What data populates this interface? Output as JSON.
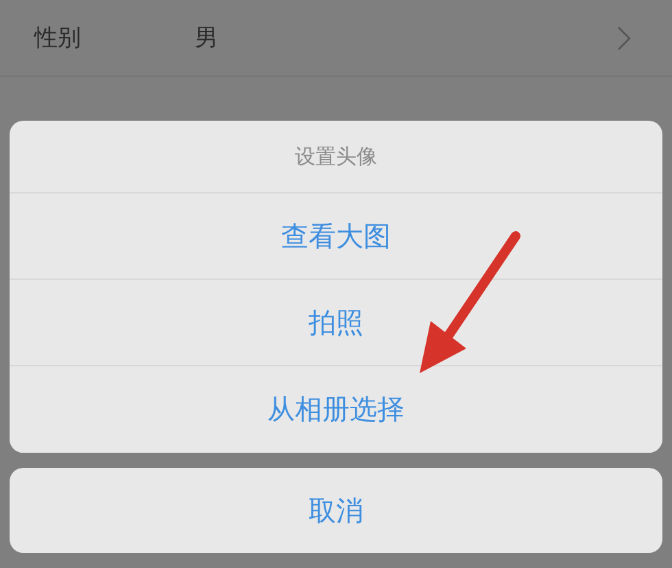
{
  "profile_rows": [
    {
      "label": "性别",
      "value": "男"
    }
  ],
  "action_sheet": {
    "title": "设置头像",
    "options": [
      "查看大图",
      "拍照",
      "从相册选择"
    ],
    "cancel": "取消"
  },
  "annotation": {
    "kind": "arrow"
  }
}
